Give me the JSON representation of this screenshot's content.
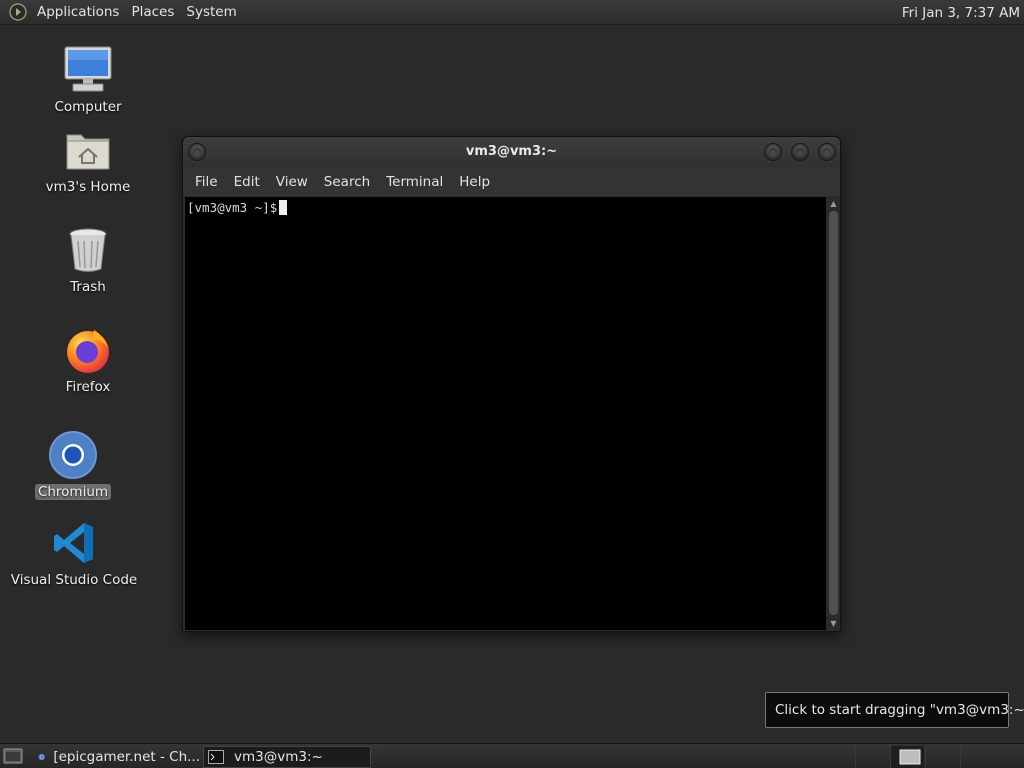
{
  "top_panel": {
    "menus": [
      "Applications",
      "Places",
      "System"
    ],
    "clock": "Fri Jan  3,  7:37 AM"
  },
  "desktop": {
    "icons": [
      {
        "label": "Computer",
        "icon": "computer-icon"
      },
      {
        "label": "vm3's Home",
        "icon": "home-folder-icon"
      },
      {
        "label": "Trash",
        "icon": "trash-icon"
      },
      {
        "label": "Firefox",
        "icon": "firefox-icon"
      },
      {
        "label": "Chromium",
        "icon": "chromium-icon",
        "selected": true
      },
      {
        "label": "Visual Studio Code",
        "icon": "vscode-icon"
      }
    ]
  },
  "terminal": {
    "title": "vm3@vm3:~",
    "menu": [
      "File",
      "Edit",
      "View",
      "Search",
      "Terminal",
      "Help"
    ],
    "prompt": "[vm3@vm3 ~]$"
  },
  "tooltip": {
    "text": "Click to start dragging \"vm3@vm3:~\""
  },
  "bottom_panel": {
    "tasks": [
      {
        "label": "[epicgamer.net - Ch...",
        "icon": "chromium-icon"
      },
      {
        "label": "vm3@vm3:~",
        "icon": "terminal-icon",
        "active": true
      }
    ]
  }
}
